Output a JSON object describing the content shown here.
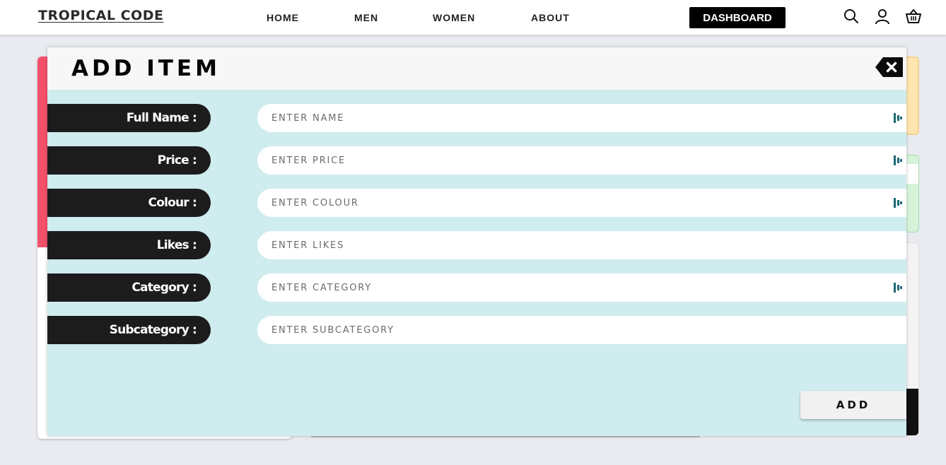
{
  "header": {
    "brand": "TROPICAL CODE",
    "nav": [
      {
        "label": "HOME"
      },
      {
        "label": "MEN"
      },
      {
        "label": "WOMEN"
      },
      {
        "label": "ABOUT"
      }
    ],
    "dashboard_label": "DASHBOARD",
    "icons": [
      "search-icon",
      "user-icon",
      "basket-icon"
    ]
  },
  "modal": {
    "title": "ADD ITEM",
    "close_icon": "backspace-close-icon",
    "fields": [
      {
        "label": "Full Name :",
        "placeholder": "ENTER NAME",
        "icon": "password-manager-icon"
      },
      {
        "label": "Price :",
        "placeholder": "ENTER PRICE",
        "icon": "password-manager-icon"
      },
      {
        "label": "Colour :",
        "placeholder": "ENTER COLOUR",
        "icon": "password-manager-icon"
      },
      {
        "label": "Likes :",
        "placeholder": "ENTER LIKES"
      },
      {
        "label": "Category :",
        "placeholder": "ENTER CATEGORY",
        "icon": "password-manager-icon"
      },
      {
        "label": "Subcategory :",
        "placeholder": "ENTER SUBCATEGORY"
      }
    ],
    "add_label": "ADD"
  },
  "colors": {
    "accent_pink": "#f4506a",
    "modal_bg": "#cfecee",
    "label_bg": "#1c1c1c"
  }
}
